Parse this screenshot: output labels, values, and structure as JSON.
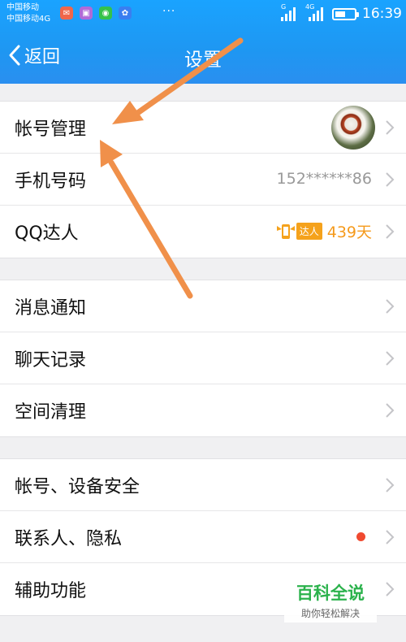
{
  "status_bar": {
    "carrier1": "中国移动",
    "carrier2": "中国移动4G",
    "time": "16:39",
    "network1": "G",
    "network2": "4G",
    "battery_level": 0.55,
    "app_icons": [
      "message-icon",
      "gallery-icon",
      "wechat-icon",
      "baidu-icon"
    ],
    "more": "···"
  },
  "nav": {
    "back_label": "返回",
    "title": "设置"
  },
  "groups": [
    {
      "items": [
        {
          "label": "帐号管理",
          "accessory": "avatar"
        },
        {
          "label": "手机号码",
          "value": "152******86"
        },
        {
          "label": "QQ达人",
          "badge": "达人",
          "days": "439天"
        }
      ]
    },
    {
      "items": [
        {
          "label": "消息通知"
        },
        {
          "label": "聊天记录"
        },
        {
          "label": "空间清理"
        }
      ]
    },
    {
      "items": [
        {
          "label": "帐号、设备安全"
        },
        {
          "label": "联系人、隐私",
          "red_dot": true
        },
        {
          "label": "辅助功能"
        }
      ]
    }
  ],
  "watermark": {
    "title": "百科全说",
    "subtitle": "助你轻松解决"
  },
  "colors": {
    "header_blue": "#1e97f2",
    "arrow_orange": "#f0904a",
    "daren_orange": "#f59a1c",
    "badge_red": "#f04a30",
    "watermark_green": "#2bb24c"
  }
}
